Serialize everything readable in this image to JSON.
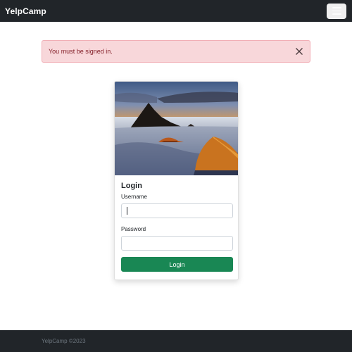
{
  "navbar": {
    "brand": "YelpCamp",
    "toggler_icon": "hamburger-menu-icon"
  },
  "alert": {
    "message": "You must be signed in.",
    "close_icon": "close-icon",
    "background": "#f8d7da",
    "text_color": "#842029"
  },
  "card": {
    "image": "campsite-mountain-sunset-tents",
    "title": "Login",
    "username": {
      "label": "Username",
      "value": "",
      "placeholder": ""
    },
    "password": {
      "label": "Password",
      "value": "",
      "placeholder": ""
    },
    "submit_label": "Login",
    "button_color": "#198754"
  },
  "footer": {
    "text": "YelpCamp ©2023"
  },
  "colors": {
    "dark": "#212529",
    "footer_text": "#6c757d"
  }
}
